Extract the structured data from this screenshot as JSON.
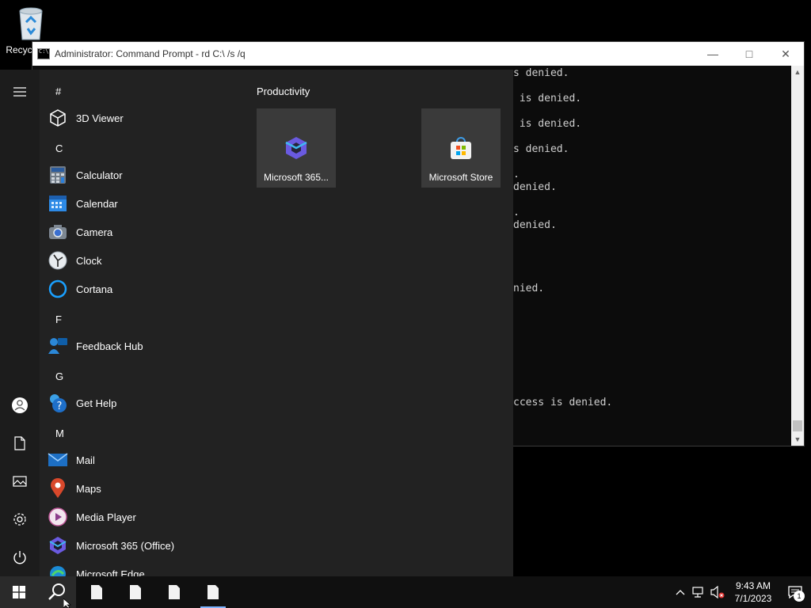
{
  "desktop": {
    "recycle_bin_label": "Recycle Bin"
  },
  "console": {
    "title": "Administrator:  Command Prompt - rd  C:\\ /s /q",
    "lines": [
      "s denied.",
      " is denied.",
      " is denied.",
      "s denied.",
      ".",
      "denied.",
      ".",
      "denied.",
      "nied.",
      "ccess is denied."
    ]
  },
  "start_menu": {
    "letters": [
      "#",
      "C",
      "F",
      "G",
      "M"
    ],
    "apps": [
      {
        "label": "3D Viewer",
        "icon": "cube-icon"
      },
      {
        "label": "Calculator",
        "icon": "calculator-icon"
      },
      {
        "label": "Calendar",
        "icon": "calendar-icon"
      },
      {
        "label": "Camera",
        "icon": "camera-icon"
      },
      {
        "label": "Clock",
        "icon": "clock-icon"
      },
      {
        "label": "Cortana",
        "icon": "cortana-icon"
      },
      {
        "label": "Feedback Hub",
        "icon": "feedback-icon"
      },
      {
        "label": "Get Help",
        "icon": "help-icon"
      },
      {
        "label": "Mail",
        "icon": "mail-icon"
      },
      {
        "label": "Maps",
        "icon": "map-pin-icon"
      },
      {
        "label": "Media Player",
        "icon": "play-icon"
      },
      {
        "label": "Microsoft 365 (Office)",
        "icon": "office-icon"
      },
      {
        "label": "Microsoft Edge",
        "icon": "edge-icon"
      }
    ],
    "tiles_group": "Productivity",
    "tiles": [
      {
        "label": "Microsoft 365...",
        "icon": "office-icon"
      },
      {
        "label": "Microsoft Store",
        "icon": "store-icon"
      }
    ]
  },
  "taskbar": {
    "time": "9:43 AM",
    "date": "7/1/2023",
    "notification_count": "1"
  },
  "colors": {
    "start_bg": "#222222",
    "taskbar_bg": "#101010",
    "accent": "#7fb5ff"
  }
}
